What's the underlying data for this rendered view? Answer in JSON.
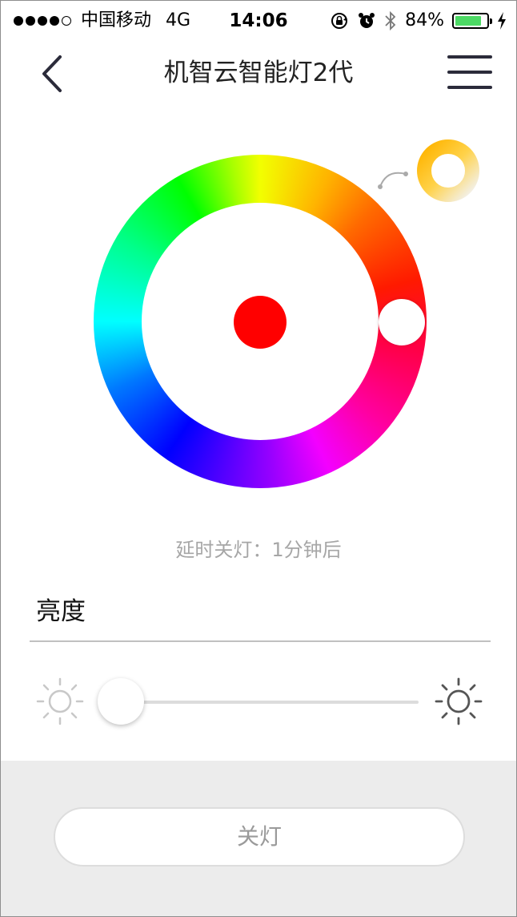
{
  "status_bar": {
    "carrier": "中国移动",
    "network": "4G",
    "time": "14:06",
    "battery_percent": "84%",
    "battery_level": 0.84,
    "icons": [
      "rotation-lock-icon",
      "alarm-icon",
      "bluetooth-icon",
      "battery-icon",
      "charging-bolt-icon"
    ]
  },
  "nav": {
    "title": "机智云智能灯2代",
    "back_icon": "chevron-left-icon",
    "menu_icon": "hamburger-menu-icon"
  },
  "color_control": {
    "selected_color": "#ff0000",
    "mode_switch_icon": "color-temperature-toggle-icon"
  },
  "timer": {
    "text": "延时关灯：1分钟后"
  },
  "brightness": {
    "label": "亮度",
    "level": 0.0,
    "min_icon": "sun-dim-icon",
    "max_icon": "sun-bright-icon"
  },
  "power": {
    "button_label": "关灯"
  },
  "colors": {
    "accent": "#4cd964",
    "bottom_panel": "#ececec",
    "muted_text": "#a6a6a6"
  }
}
